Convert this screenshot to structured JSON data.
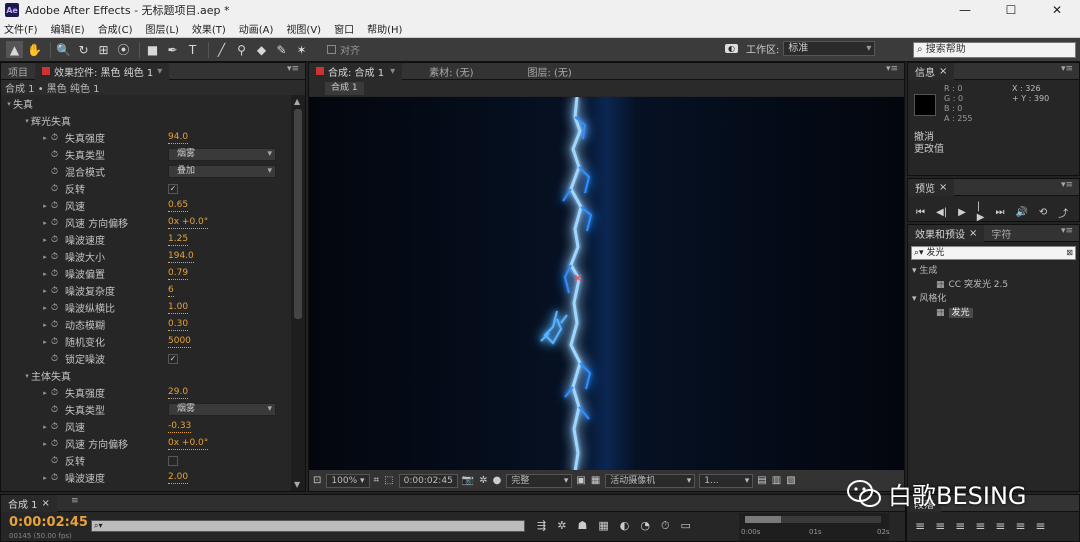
{
  "window": {
    "app_icon": "Ae",
    "title": "Adobe After Effects - 无标题项目.aep *",
    "controls": {
      "minimize": "—",
      "maximize": "☐",
      "close": "✕"
    }
  },
  "menu": [
    "文件(F)",
    "编辑(E)",
    "合成(C)",
    "图层(L)",
    "效果(T)",
    "动画(A)",
    "视图(V)",
    "窗口",
    "帮助(H)"
  ],
  "toolbar": {
    "tools": [
      "▲",
      "✋",
      "🔍",
      "↻",
      "⊞",
      "⦿",
      "■",
      "✒",
      "T",
      "╱",
      "⚲",
      "◆",
      "✎",
      "✶"
    ],
    "snap_label": "对齐",
    "workspace_label": "工作区:",
    "workspace_value": "标准",
    "search_help": "搜索帮助"
  },
  "left_panel": {
    "tabs": [
      "项目",
      "效果控件: 黑色 纯色 1"
    ],
    "subheader": "合成 1 • 黑色 纯色 1",
    "rows": [
      {
        "indent": 4,
        "tri": "▾",
        "label": "失真"
      },
      {
        "indent": 22,
        "tri": "▾",
        "label": "辉光失真"
      },
      {
        "indent": 40,
        "tri": "▸",
        "sw": "⏱",
        "label": "失真强度",
        "value": "94.0"
      },
      {
        "indent": 40,
        "sw": "⏱",
        "label": "失真类型",
        "dropdown": "烟雾"
      },
      {
        "indent": 40,
        "sw": "⏱",
        "label": "混合模式",
        "dropdown": "叠加"
      },
      {
        "indent": 40,
        "sw": "⏱",
        "label": "反转",
        "check": "✓"
      },
      {
        "indent": 40,
        "tri": "▸",
        "sw": "⏱",
        "label": "风速",
        "value": "0.65"
      },
      {
        "indent": 40,
        "tri": "▸",
        "sw": "⏱",
        "label": "风速 方向偏移",
        "value": "0x +0.0°"
      },
      {
        "indent": 40,
        "tri": "▸",
        "sw": "⏱",
        "label": "噪波速度",
        "value": "1.25"
      },
      {
        "indent": 40,
        "tri": "▸",
        "sw": "⏱",
        "label": "噪波大小",
        "value": "194.0"
      },
      {
        "indent": 40,
        "tri": "▸",
        "sw": "⏱",
        "label": "噪波偏置",
        "value": "0.79"
      },
      {
        "indent": 40,
        "tri": "▸",
        "sw": "⏱",
        "label": "噪波复杂度",
        "value": "6"
      },
      {
        "indent": 40,
        "tri": "▸",
        "sw": "⏱",
        "label": "噪波纵横比",
        "value": "1.00"
      },
      {
        "indent": 40,
        "tri": "▸",
        "sw": "⏱",
        "label": "动态模糊",
        "value": "0.30"
      },
      {
        "indent": 40,
        "tri": "▸",
        "sw": "⏱",
        "label": "随机变化",
        "value": "5000"
      },
      {
        "indent": 40,
        "sw": "⏱",
        "label": "锁定噪波",
        "check": "✓"
      },
      {
        "indent": 22,
        "tri": "▾",
        "label": "主体失真"
      },
      {
        "indent": 40,
        "tri": "▸",
        "sw": "⏱",
        "label": "失真强度",
        "value": "29.0"
      },
      {
        "indent": 40,
        "sw": "⏱",
        "label": "失真类型",
        "dropdown": "烟雾"
      },
      {
        "indent": 40,
        "tri": "▸",
        "sw": "⏱",
        "label": "风速",
        "value": "-0.33"
      },
      {
        "indent": 40,
        "tri": "▸",
        "sw": "⏱",
        "label": "风速 方向偏移",
        "value": "0x +0.0°"
      },
      {
        "indent": 40,
        "sw": "⏱",
        "label": "反转",
        "check": ""
      },
      {
        "indent": 40,
        "tri": "▸",
        "sw": "⏱",
        "label": "噪波速度",
        "value": "2.00"
      }
    ]
  },
  "comp_panel": {
    "tabs": [
      "合成: 合成 1",
      "素材: (无)",
      "图层: (无)"
    ],
    "subtab": "合成 1",
    "bar": {
      "zoom": "100%",
      "timecode": "0:00:02:45",
      "resolution": "完整",
      "camera": "活动摄像机",
      "views": "1..."
    }
  },
  "info_panel": {
    "tab": "信息",
    "r": "R : 0",
    "g": "G : 0",
    "b": "B : 0",
    "a": "A : 255",
    "x": "X : 326",
    "y": "+ Y : 390",
    "msg1": "撤消",
    "msg2": "更改值"
  },
  "preview_panel": {
    "tab": "预览",
    "controls": [
      "⏮",
      "◀|",
      "▶",
      "|▶",
      "⏭",
      "🔊",
      "⟲",
      "⤴"
    ]
  },
  "effects_panel": {
    "tabs": [
      "效果和预设",
      "字符"
    ],
    "search": "发光",
    "tree": [
      {
        "indent": 4,
        "text": "▾ 生成"
      },
      {
        "indent": 28,
        "text": "CC 突发光 2.5",
        "icon": "▦"
      },
      {
        "indent": 4,
        "text": "▾ 风格化"
      },
      {
        "indent": 28,
        "text": "发光",
        "icon": "▦",
        "highlight": true
      }
    ]
  },
  "timeline": {
    "tab": "合成 1",
    "time": "0:00:02:45",
    "frames": "00145 (50.00 fps)",
    "search": "⌕▾",
    "ruler": [
      "0:00s",
      "01s",
      "02s"
    ]
  },
  "paragraph_panel": {
    "tab": "段落"
  },
  "watermark": "白歌BESING",
  "colors": {
    "accent": "#e8a23a",
    "lightning": "#3aa0ff"
  }
}
